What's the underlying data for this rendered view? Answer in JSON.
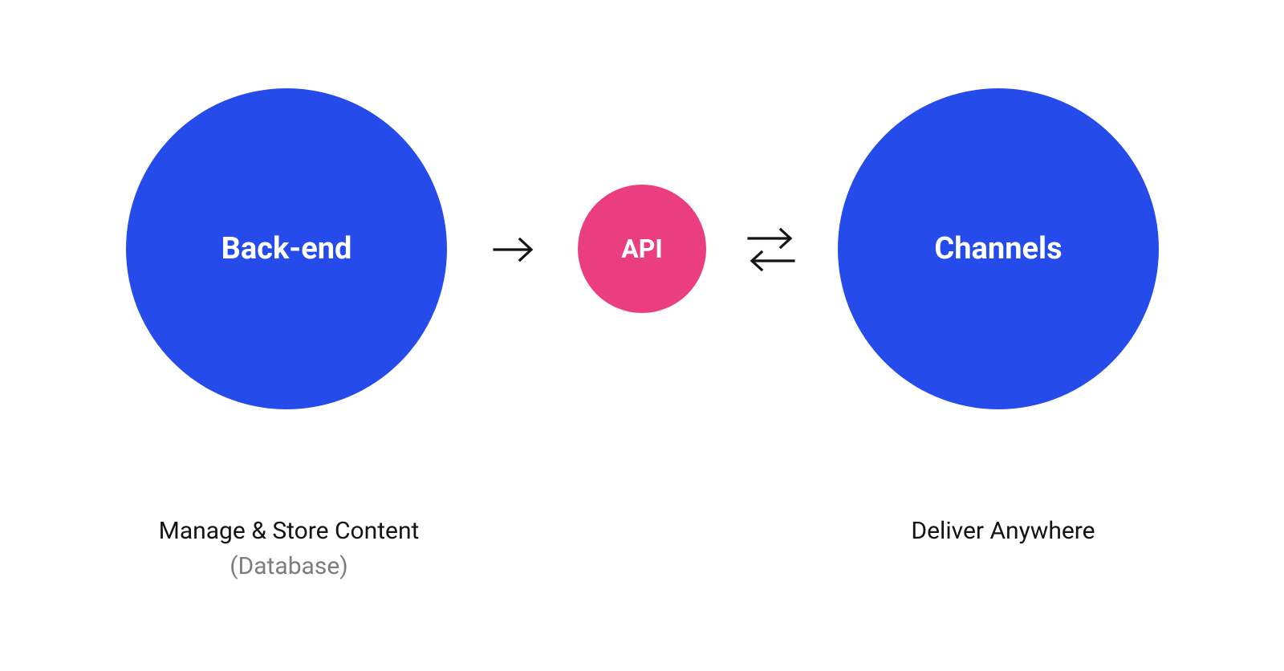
{
  "colors": {
    "blue": "#254BEB",
    "pink": "#EA3E81",
    "text": "#131313",
    "subtext": "#7d7d7d",
    "arrow": "#131313"
  },
  "nodes": {
    "backend": {
      "label": "Back-end"
    },
    "api": {
      "label": "API"
    },
    "channels": {
      "label": "Channels"
    }
  },
  "captions": {
    "left": {
      "line1": "Manage & Store Content",
      "line2": "(Database)"
    },
    "right": {
      "line1": "Deliver Anywhere"
    }
  }
}
